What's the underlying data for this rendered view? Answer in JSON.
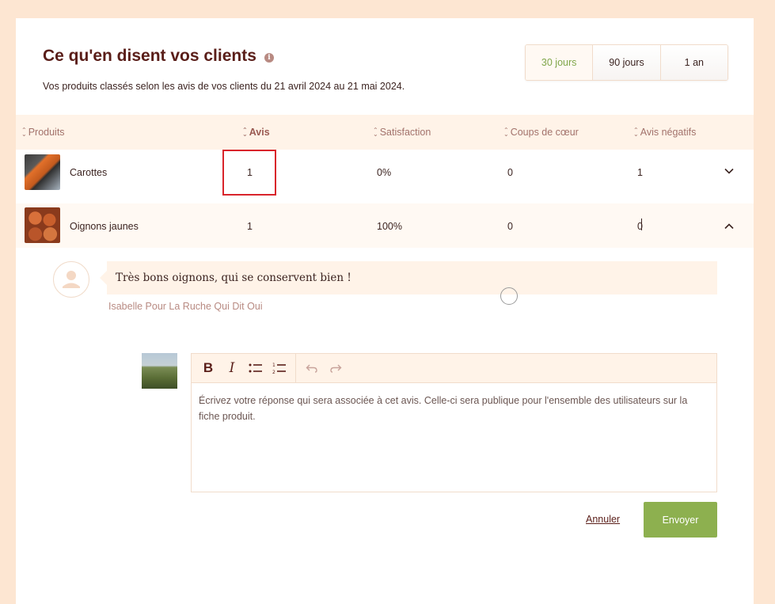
{
  "header": {
    "title": "Ce qu'en disent vos clients",
    "info_icon": "info-icon",
    "subtitle": "Vos produits classés selon les avis de vos clients du 21 avril 2024 au 21 mai 2024."
  },
  "periods": [
    {
      "label": "30 jours",
      "selected": true
    },
    {
      "label": "90 jours",
      "selected": false
    },
    {
      "label": "1 an",
      "selected": false
    }
  ],
  "table": {
    "columns": [
      "Produits",
      "Avis",
      "Satisfaction",
      "Coups de cœur",
      "Avis négatifs"
    ],
    "active_column": "Avis",
    "rows": [
      {
        "product": "Carottes",
        "avis": "1",
        "satisfaction": "0%",
        "coups": "0",
        "negatifs": "1",
        "expanded": false
      },
      {
        "product": "Oignons jaunes",
        "avis": "1",
        "satisfaction": "100%",
        "coups": "0",
        "negatifs": "0",
        "expanded": true
      }
    ]
  },
  "review": {
    "text": "Très bons oignons, qui se conservent bien !",
    "author": "Isabelle Pour La Ruche Qui Dit Oui"
  },
  "reply": {
    "placeholder": "Écrivez votre réponse qui sera associée à cet avis. Celle-ci sera publique pour l'ensemble des utilisateurs sur la fiche produit.",
    "cancel_label": "Annuler",
    "send_label": "Envoyer"
  },
  "colors": {
    "background": "#fde6d2",
    "title": "#5a1e19",
    "accent_green": "#8db04f",
    "highlight": "#d9242b"
  }
}
